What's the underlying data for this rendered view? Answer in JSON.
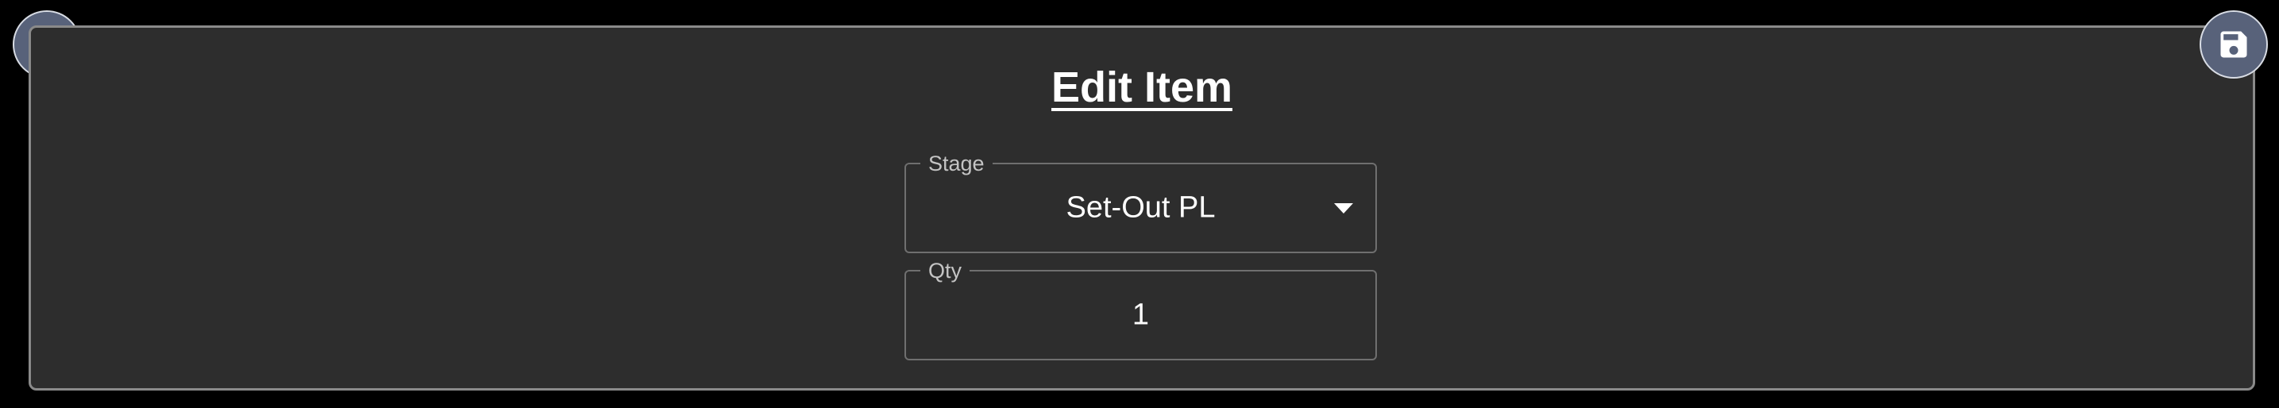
{
  "dialog": {
    "title": "Edit Item",
    "close_icon": "close-icon",
    "save_icon": "save-icon"
  },
  "stage": {
    "label": "Stage",
    "value": "Set-Out PL",
    "dropdown_icon": "dropdown-arrow-icon"
  },
  "qty": {
    "label": "Qty",
    "value": "1"
  },
  "colors": {
    "background": "#000000",
    "dialog_bg": "#2d2d2d",
    "button_bg": "#58627a",
    "text": "#ffffff"
  }
}
